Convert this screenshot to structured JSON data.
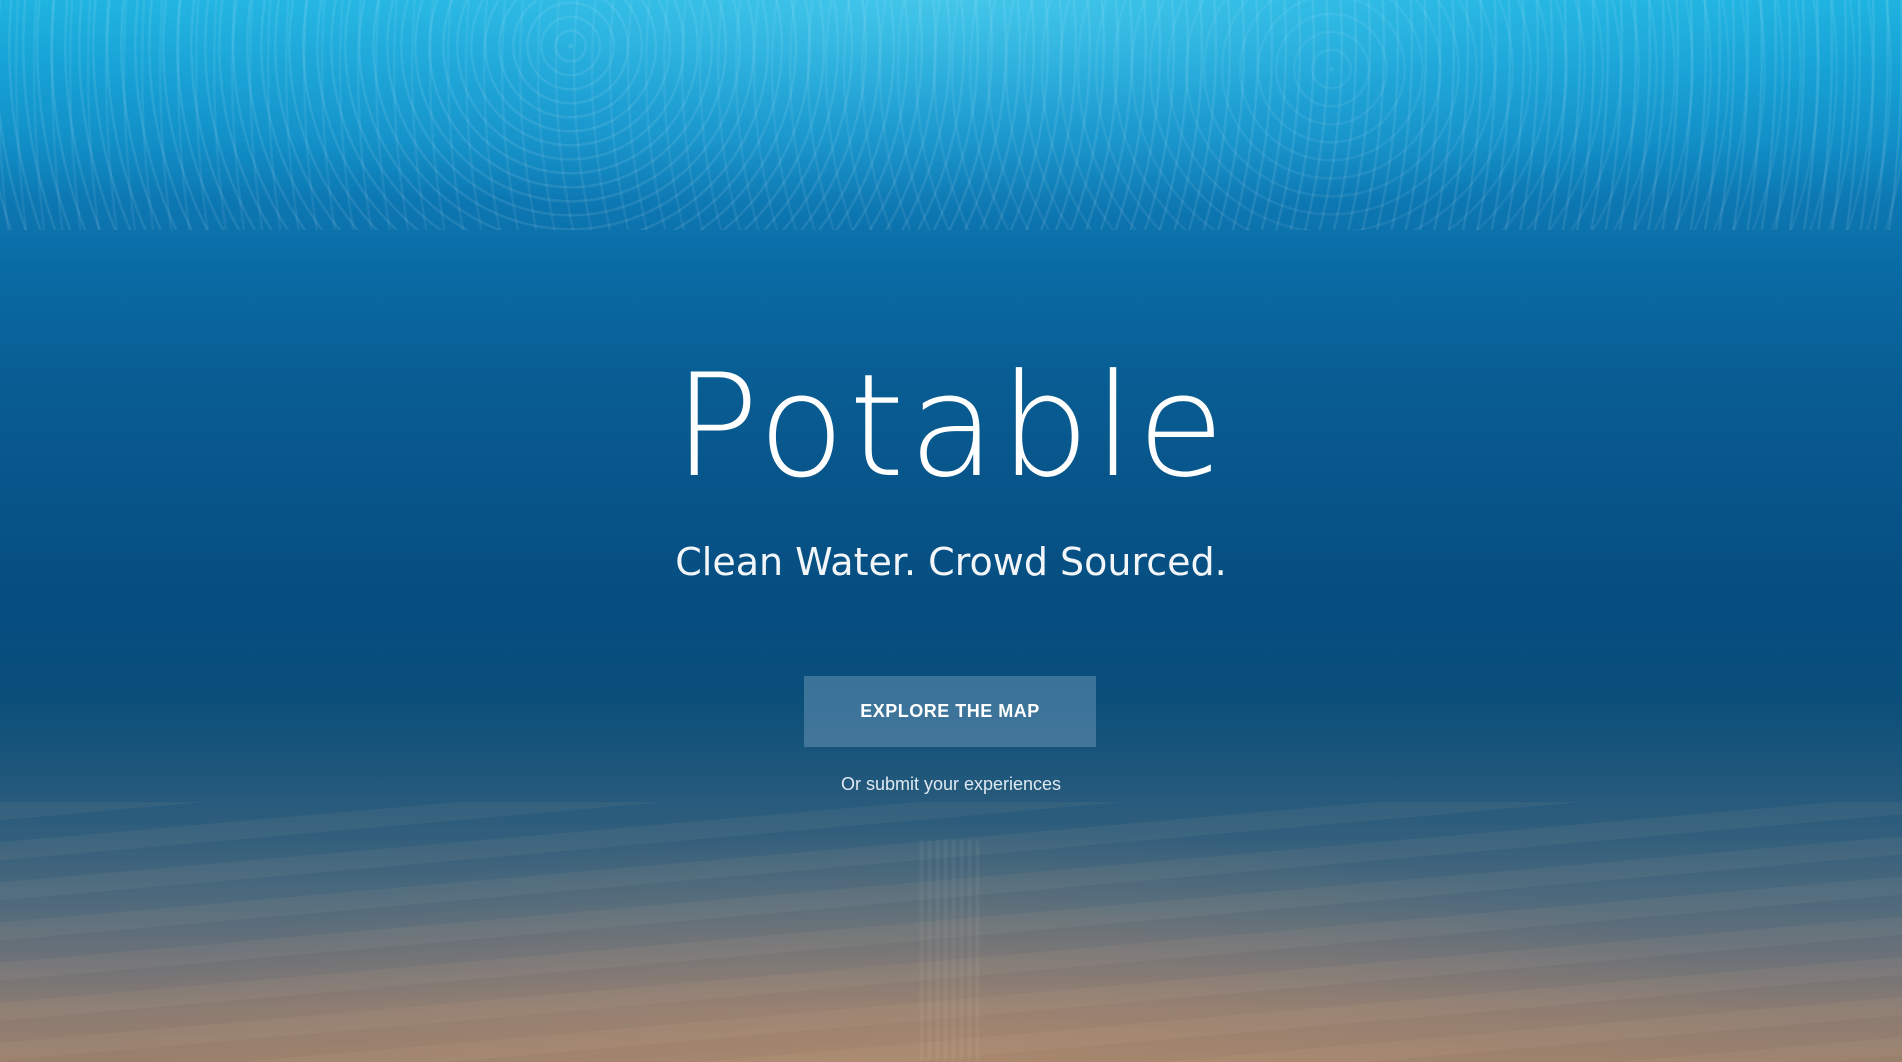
{
  "hero": {
    "title": "Potable",
    "tagline": "Clean Water. Crowd Sourced.",
    "cta_label": "EXPLORE THE MAP",
    "secondary_link": "Or submit your experiences"
  },
  "colors": {
    "surface_top": "#1fb3e0",
    "mid_water": "#075388",
    "sea_floor": "#9a806c",
    "text": "#ffffff",
    "button_bg": "#4d7ea0"
  }
}
